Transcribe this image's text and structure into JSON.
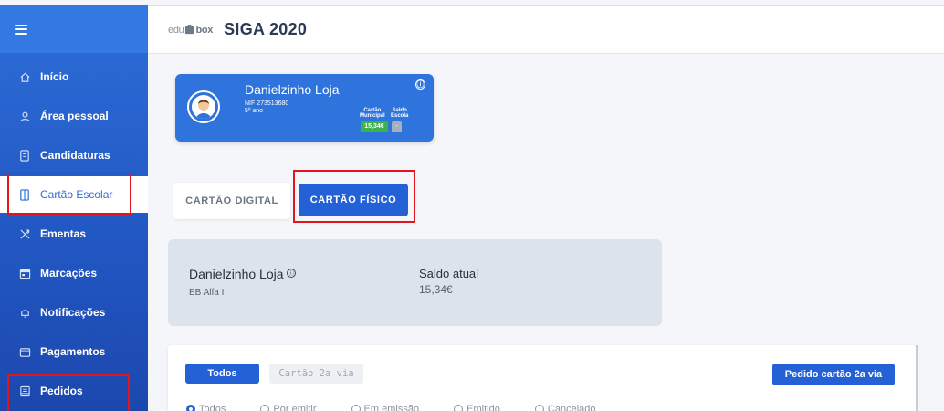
{
  "header": {
    "logo_text_light": "edu",
    "logo_text_bold": "box",
    "title": "SIGA 2020"
  },
  "sidebar": {
    "items": [
      {
        "label": "Início",
        "icon": "home-icon"
      },
      {
        "label": "Área pessoal",
        "icon": "user-icon"
      },
      {
        "label": "Candidaturas",
        "icon": "document-icon"
      },
      {
        "label": "Cartão Escolar",
        "icon": "card-icon",
        "active": true
      },
      {
        "label": "Ementas",
        "icon": "cutlery-icon"
      },
      {
        "label": "Marcações",
        "icon": "calendar-icon"
      },
      {
        "label": "Notificações",
        "icon": "bell-icon"
      },
      {
        "label": "Pagamentos",
        "icon": "wallet-icon"
      },
      {
        "label": "Pedidos",
        "icon": "orders-icon"
      }
    ]
  },
  "profile": {
    "name": "Danielzinho Loja",
    "nif": "NIF 273513680",
    "grade": "5º ano",
    "col1_line1": "Cartão",
    "col1_line2": "Municipal",
    "col2_line1": "Saldo",
    "col2_line2": "Escola",
    "municipal_balance": "15,34€",
    "school_balance": "-",
    "info_symbol": "ⓘ"
  },
  "tabs": {
    "digital": "CARTÃO DIGITAL",
    "fisico": "CARTÃO FÍSICO"
  },
  "balance_card": {
    "name": "Danielzinho Loja",
    "school": "EB Alfa I",
    "label": "Saldo atual",
    "value": "15,34€"
  },
  "orders": {
    "filter_all": "Todos",
    "filter_2via": "Cartão 2a via",
    "request_button": "Pedido cartão 2a via",
    "radios": [
      "Todos",
      "Por emitir",
      "Em emissão",
      "Emitido",
      "Cancelado"
    ]
  },
  "colors": {
    "primary": "#2461d6",
    "sidebar": "#2d6ed8",
    "highlight": "#e3141b",
    "balance_green": "#3ab44a"
  }
}
